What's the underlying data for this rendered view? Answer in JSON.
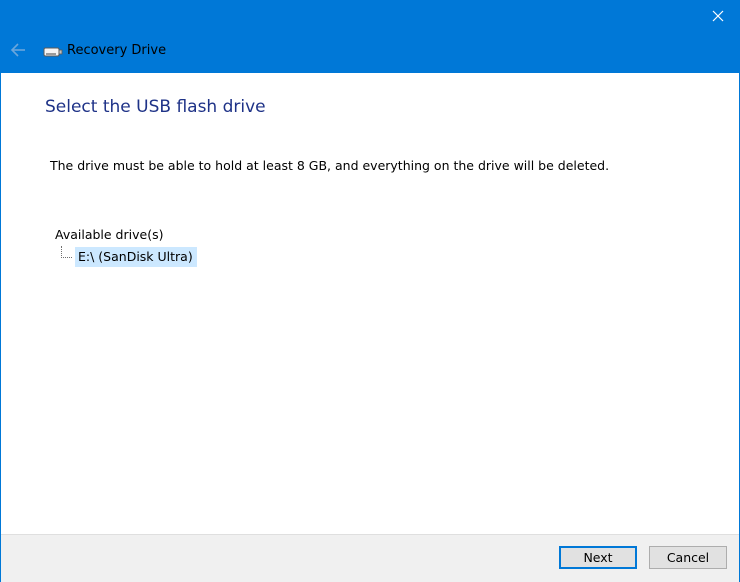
{
  "window": {
    "title": "Recovery Drive",
    "accent_color": "#0078d7",
    "heading_color": "#1e3287"
  },
  "titlebar": {
    "back_icon": "arrow-left-icon",
    "app_icon": "usb-drive-icon",
    "close_icon": "close-icon"
  },
  "content": {
    "heading": "Select the USB flash drive",
    "description": "The drive must be able to hold at least 8 GB, and everything on the drive will be deleted.",
    "drives_label": "Available drive(s)",
    "drives": [
      {
        "label": "E:\\ (SanDisk Ultra)",
        "selected": true
      }
    ]
  },
  "footer": {
    "next_label": "Next",
    "cancel_label": "Cancel"
  }
}
